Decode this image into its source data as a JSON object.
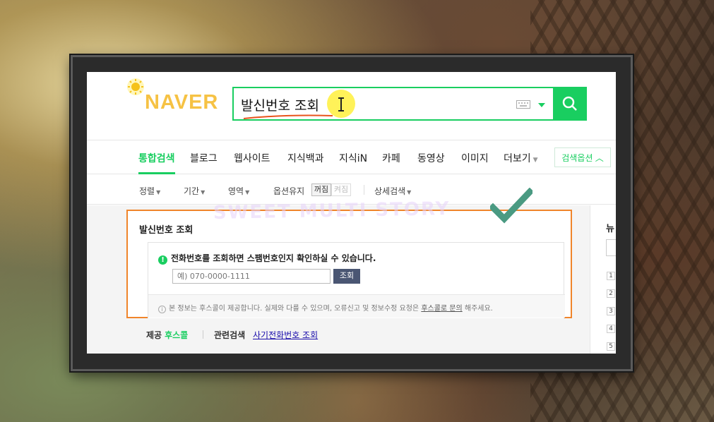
{
  "search": {
    "logo": "NAVER",
    "query": "발신번호 조회"
  },
  "tabs": [
    {
      "label": "통합검색",
      "active": true
    },
    {
      "label": "블로그"
    },
    {
      "label": "웹사이트"
    },
    {
      "label": "지식백과"
    },
    {
      "label": "지식iN"
    },
    {
      "label": "카페"
    },
    {
      "label": "동영상"
    },
    {
      "label": "이미지"
    },
    {
      "label": "더보기"
    }
  ],
  "search_options": "검색옵션",
  "filters": {
    "sort": "정렬",
    "period": "기간",
    "area": "영역",
    "keep_options": "옵션유지",
    "toggle_on": "꺼짐",
    "toggle_off": "켜짐",
    "advanced": "상세검색"
  },
  "card": {
    "title": "발신번호 조회",
    "info": "전화번호를 조회하면 스팸번호인지 확인하실 수 있습니다.",
    "input_placeholder": "예) 070-0000-1111",
    "button": "조회",
    "notice_prefix": "본 정보는 후스콜이 제공합니다. 실제와 다를 수 있으며, 오류신고 및 정보수정 요청은 ",
    "notice_link": "후스콜로 문의",
    "notice_suffix": " 해주세요."
  },
  "footer": {
    "provider_label": "제공",
    "provider_name": "후스콜",
    "related_label": "관련검색",
    "related_link": "사기전화번호 조회"
  },
  "side_panel": {
    "title": "뉴",
    "ranks": [
      "1",
      "2",
      "3",
      "4",
      "5"
    ]
  },
  "watermark": "SWEET MULTI STORY",
  "colors": {
    "naver_green": "#19ce60",
    "highlight_orange": "#f0852b",
    "logo_yellow": "#f6c244"
  }
}
